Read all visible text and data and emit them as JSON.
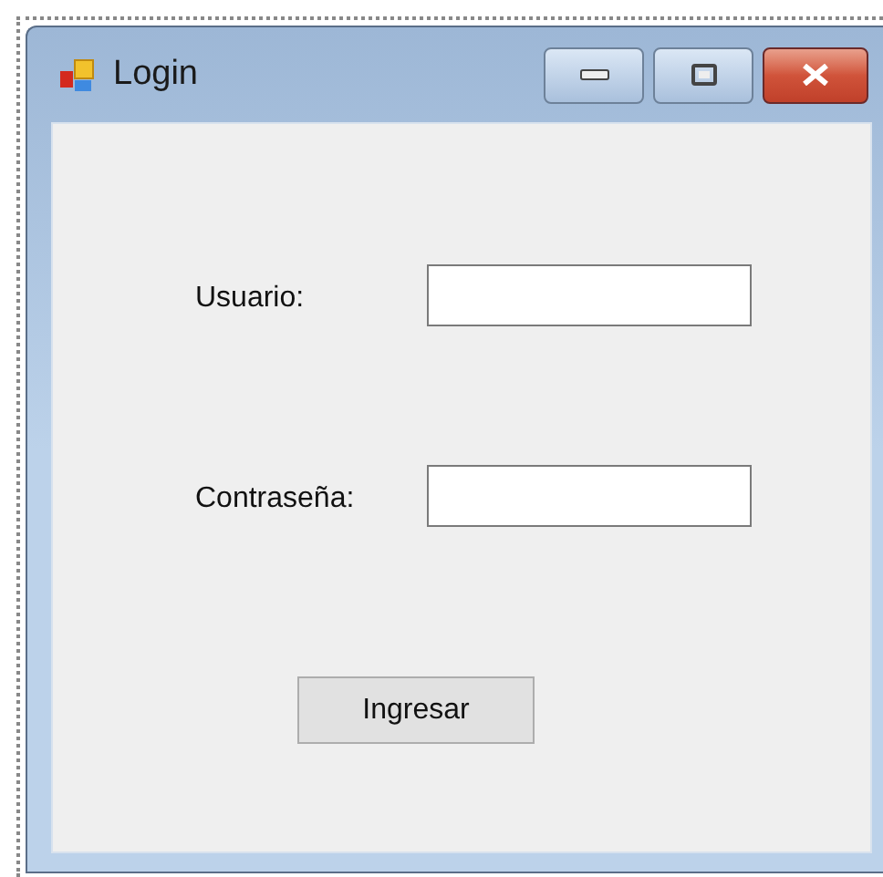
{
  "window": {
    "title": "Login"
  },
  "fields": [
    {
      "label": "Usuario:"
    },
    {
      "label": "Contraseña:"
    }
  ],
  "buttons": [
    "Ingresar"
  ]
}
